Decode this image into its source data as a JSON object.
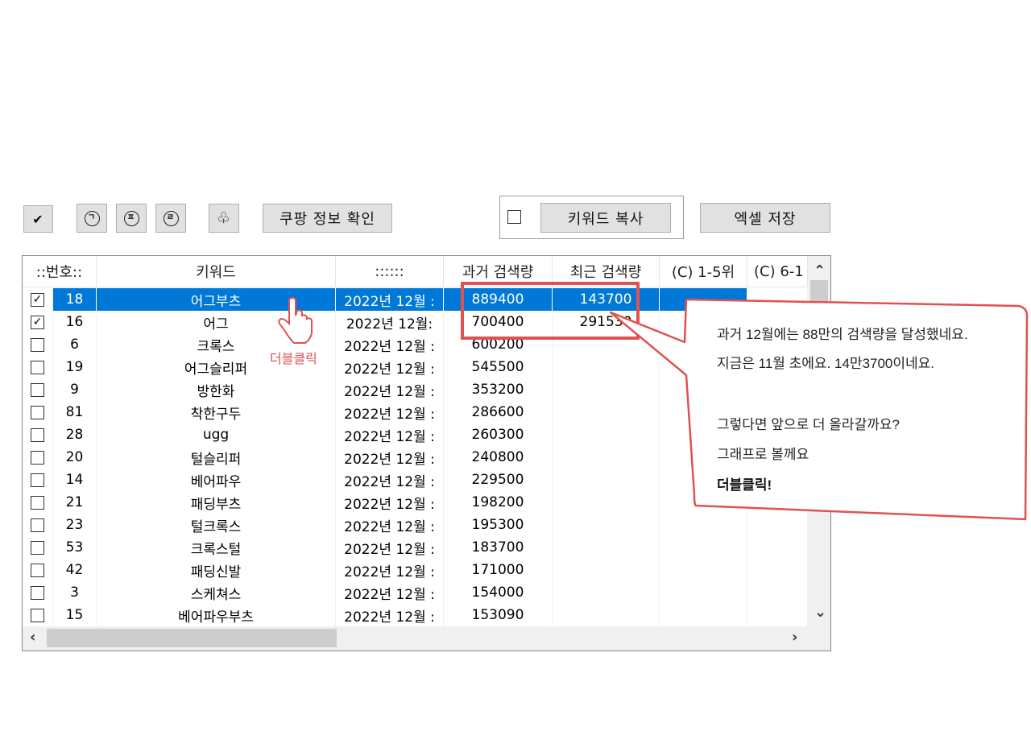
{
  "toolbar": {
    "check_icon": "✔",
    "btn_g": "ㄱ",
    "btn_p": "ㅍ",
    "btn_r": "ㄹ",
    "clover_icon": "♧",
    "coupang_label": "쿠팡 정보 확인",
    "keyword_copy_label": "키워드 복사",
    "excel_save_label": "엑셀 저장"
  },
  "grid": {
    "headers": [
      "::번호::",
      "키워드",
      "::::::",
      "과거 검색량",
      "최근 검색량",
      "(C) 1-5위",
      "(C) 6-1"
    ],
    "rows": [
      {
        "checked": true,
        "no": "18",
        "kw": "어그부츠",
        "date": "2022년 12월 :",
        "past": "889400",
        "recent": "143700",
        "selected": true
      },
      {
        "checked": true,
        "no": "16",
        "kw": "어그",
        "date": "2022년 12월:",
        "past": "700400",
        "recent": "291530",
        "selected": false
      },
      {
        "checked": false,
        "no": "6",
        "kw": "크록스",
        "date": "2022년 12월 :",
        "past": "600200",
        "recent": "",
        "selected": false
      },
      {
        "checked": false,
        "no": "19",
        "kw": "어그슬리퍼",
        "date": "2022년 12월 :",
        "past": "545500",
        "recent": "",
        "selected": false
      },
      {
        "checked": false,
        "no": "9",
        "kw": "방한화",
        "date": "2022년 12월 :",
        "past": "353200",
        "recent": "",
        "selected": false
      },
      {
        "checked": false,
        "no": "81",
        "kw": "착한구두",
        "date": "2022년 12월 :",
        "past": "286600",
        "recent": "",
        "selected": false
      },
      {
        "checked": false,
        "no": "28",
        "kw": "ugg",
        "date": "2022년 12월 :",
        "past": "260300",
        "recent": "",
        "selected": false
      },
      {
        "checked": false,
        "no": "20",
        "kw": "털슬리퍼",
        "date": "2022년 12월 :",
        "past": "240800",
        "recent": "",
        "selected": false
      },
      {
        "checked": false,
        "no": "14",
        "kw": "베어파우",
        "date": "2022년 12월 :",
        "past": "229500",
        "recent": "",
        "selected": false
      },
      {
        "checked": false,
        "no": "21",
        "kw": "패딩부츠",
        "date": "2022년 12월 :",
        "past": "198200",
        "recent": "",
        "selected": false
      },
      {
        "checked": false,
        "no": "23",
        "kw": "털크록스",
        "date": "2022년 12월 :",
        "past": "195300",
        "recent": "",
        "selected": false
      },
      {
        "checked": false,
        "no": "53",
        "kw": "크록스털",
        "date": "2022년 12월 :",
        "past": "183700",
        "recent": "",
        "selected": false
      },
      {
        "checked": false,
        "no": "42",
        "kw": "패딩신발",
        "date": "2022년 12월 :",
        "past": "171000",
        "recent": "",
        "selected": false
      },
      {
        "checked": false,
        "no": "3",
        "kw": "스케쳐스",
        "date": "2022년 12월 :",
        "past": "154000",
        "recent": "",
        "selected": false
      },
      {
        "checked": false,
        "no": "15",
        "kw": "베어파우부츠",
        "date": "2022년 12월 :",
        "past": "153090",
        "recent": "",
        "selected": false
      }
    ]
  },
  "annotation": {
    "doubleclick_label": "더블클릭",
    "callout": {
      "line1": "과거 12월에는 88만의 검색량을 달성했네요.",
      "line2": "지금은 11월 초에요. 14만3700이네요.",
      "line3": "그렇다면 앞으로 더 올라갈까요?",
      "line4": "그래프로 볼께요",
      "line5": "더블클릭!"
    },
    "accent_color": "#e05252"
  }
}
